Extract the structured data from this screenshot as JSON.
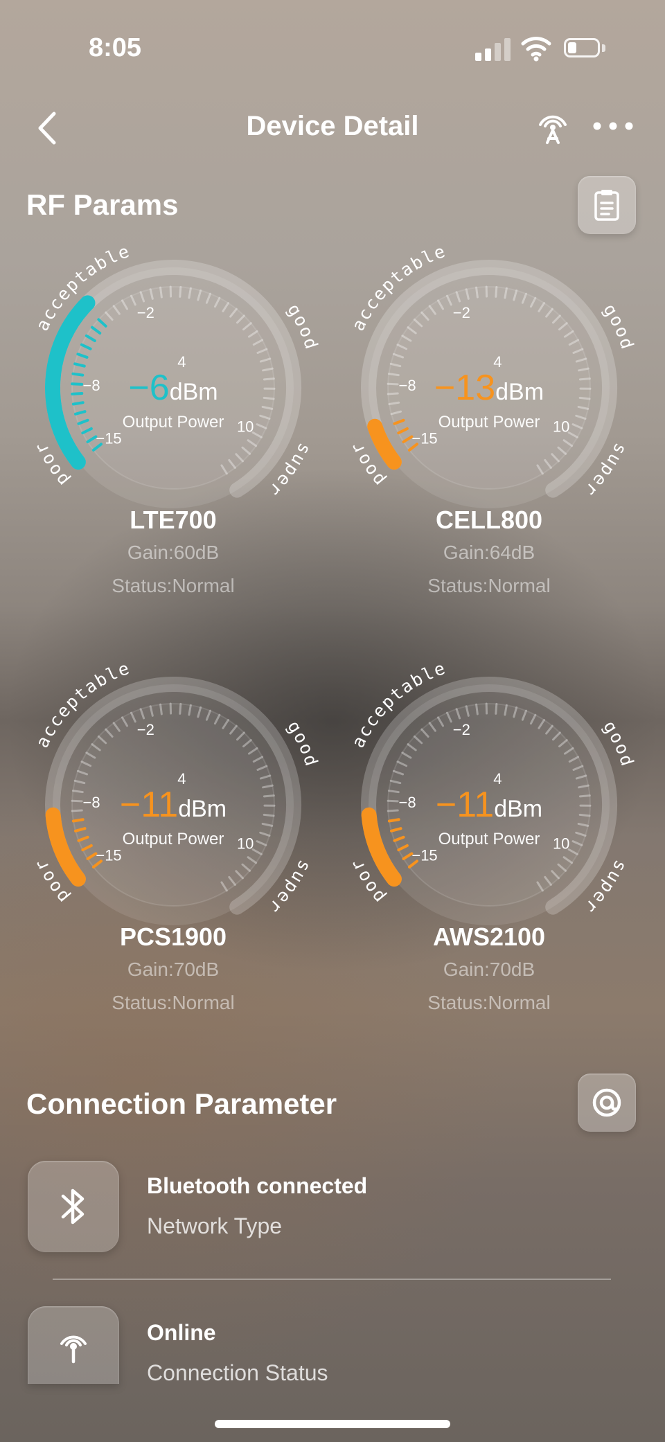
{
  "status_bar": {
    "time": "8:05"
  },
  "nav": {
    "title": "Device Detail"
  },
  "rf_section": {
    "title": "RF Params"
  },
  "gauge_labels": {
    "poor": "poor",
    "acceptable": "acceptable",
    "good": "good",
    "super": "super"
  },
  "gauge_ticks": {
    "t1": "-2",
    "t2": "4",
    "t3": "-8",
    "t4": "-15",
    "t5": "10"
  },
  "gauges": [
    {
      "value": "-6",
      "unit": "dBm",
      "label": "Output Power",
      "name": "LTE700",
      "gain": "Gain:60dB",
      "status": "Status:Normal",
      "color": "#1ec1c9",
      "level": 0.3
    },
    {
      "value": "-13",
      "unit": "dBm",
      "label": "Output Power",
      "name": "CELL800",
      "gain": "Gain:64dB",
      "status": "Status:Normal",
      "color": "#f7931e",
      "level": 0.07
    },
    {
      "value": "-11",
      "unit": "dBm",
      "label": "Output Power",
      "name": "PCS1900",
      "gain": "Gain:70dB",
      "status": "Status:Normal",
      "color": "#f7931e",
      "level": 0.12
    },
    {
      "value": "-11",
      "unit": "dBm",
      "label": "Output Power",
      "name": "AWS2100",
      "gain": "Gain:70dB",
      "status": "Status:Normal",
      "color": "#f7931e",
      "level": 0.12
    }
  ],
  "connection": {
    "title": "Connection Parameter",
    "rows": [
      {
        "title": "Bluetooth connected",
        "subtitle": "Network Type",
        "icon": "bluetooth-icon"
      },
      {
        "title": "Online",
        "subtitle": "Connection Status",
        "icon": "antenna-icon"
      }
    ]
  },
  "icons": {
    "back": "chevron-left-icon",
    "antenna": "antenna-icon",
    "more": "more-dots-icon",
    "report": "clipboard-icon",
    "connection": "at-sign-icon"
  }
}
